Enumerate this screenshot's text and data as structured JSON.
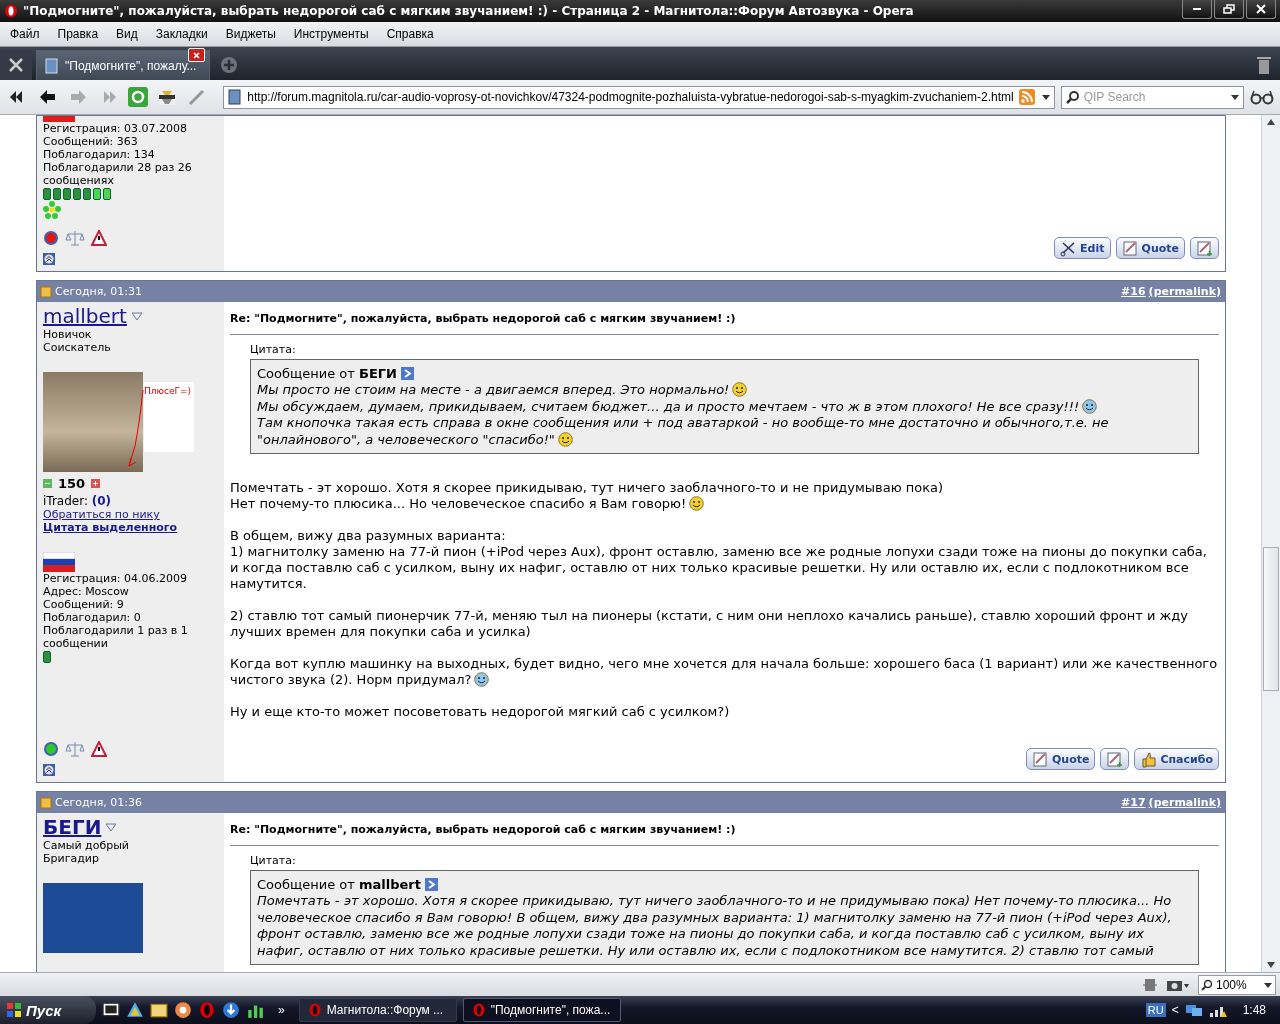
{
  "window": {
    "title": "\"Подмогните\", пожалуйста, выбрать недорогой саб с мягким звучанием! :) - Страница 2 - Магнитола::Форум Автозвука - Opera"
  },
  "menu": [
    "Файл",
    "Правка",
    "Вид",
    "Закладки",
    "Виджеты",
    "Инструменты",
    "Справка"
  ],
  "tabs": [
    {
      "label": "\"Подмогните\", пожалу...",
      "selected": true
    }
  ],
  "address": {
    "url": "http://forum.magnitola.ru/car-audio-voprosy-ot-novichkov/47324-podmognite-pozhaluista-vybratue-nedorogoi-sab-s-myagkim-zvuchaniem-2.html"
  },
  "search": {
    "placeholder": "QIP Search"
  },
  "posts": [
    {
      "flag": {
        "kind": "ru_cut"
      },
      "stats": [
        "Регистрация: 03.07.2008",
        "Сообщений: 363",
        "Поблагодарил: 134",
        "Поблагодарили 28 раз 26 сообщениях"
      ],
      "pips": [
        {
          "lit": false
        },
        {
          "lit": false
        },
        {
          "lit": false
        },
        {
          "lit": false
        },
        {
          "lit": false
        },
        {
          "lit": true
        },
        {
          "lit": true
        }
      ],
      "icq": true,
      "online": false,
      "buttons": [
        {
          "kind": "edit",
          "label": "Edit"
        },
        {
          "kind": "quote",
          "label": "Quote"
        },
        {
          "kind": "multiquote"
        }
      ]
    },
    {
      "date": "Сегодня, 01:31",
      "number": "#16",
      "permalink": "(permalink)",
      "username": "mallbert",
      "bold": false,
      "titles": [
        "Новичок",
        "Соискатель"
      ],
      "avatar": {
        "kind": "photo"
      },
      "annotation": "ПлюсеГ=)",
      "reputation": "150",
      "itrader_label": "iTrader:",
      "itrader": "(0)",
      "links": [
        "Обратиться по нику",
        "Цитата выделенного"
      ],
      "flag": {
        "kind": "ru"
      },
      "stats": [
        "Регистрация: 04.06.2009",
        "Адрес: Moscow",
        "Сообщений: 9",
        "Поблагодарил: 0",
        "Поблагодарили 1 раз в 1 сообщении"
      ],
      "pips": [
        {
          "lit": false
        }
      ],
      "online": true,
      "subject": "Re: \"Подмогните\", пожалуйста, выбрать недорогой саб с мягким звучанием! :)",
      "quote": {
        "label": "Цитата:",
        "from": "Сообщение от",
        "author": "БЕГИ",
        "lines": [
          {
            "text": "Мы просто не стоим на месте - а двигаемся вперед. Это нормально!",
            "smiley": {
              "kind": "smile"
            }
          },
          {
            "text": "Мы обсуждаем, думаем, прикидываем, считаем бюджет... да и просто мечтаем - что ж в этом плохого! Не все сразу!!!",
            "smiley": {
              "kind": "wink"
            }
          },
          {
            "text": "Там кнопочка такая есть справа в окне сообщения или + под аватаркой - но вообще-то мне достаточно и обычного,т.е. не"
          },
          {
            "text": "\"онлайнового\", а человеческого \"спасибо!\"",
            "smiley": {
              "kind": "smile"
            }
          }
        ]
      },
      "paragraphs": [
        [
          {
            "text": "Помечтать - эт хорошо. Хотя я скорее прикидываю, тут ничего заоблачного-то и не придумываю пока)"
          },
          {
            "text": "Нет почему-то плюсика... Но человеческое спасибо я Вам говорю!",
            "smiley": {
              "kind": "smile"
            }
          }
        ],
        [
          {
            "text": "В общем, вижу два разумных варианта:"
          },
          {
            "text": "1) магнитолку заменю на 77-й пион (+iPod через Aux), фронт оставлю, заменю все же родные лопухи сзади тоже на пионы до покупки саба, и когда поставлю саб с усилком, выну их нафиг, оставлю от них только красивые решетки. Ну или оставлю их, если с подлокотником все намутится."
          }
        ],
        [
          {
            "text": "2) ставлю тот самый пионерчик 77-й, меняю тыл на пионеры (кстати, с ним они неплохо качались раньше), ставлю хороший фронт и жду лучших времен для покупки саба и усилка)"
          }
        ],
        [
          {
            "text": "Когда вот куплю машинку на выходных, будет видно, чего мне хочется для начала больше: хорошего баса (1 вариант) или же качественного"
          },
          {
            "text": "чистого звука (2). Норм придумал?",
            "smiley": {
              "kind": "wink"
            }
          }
        ],
        [
          {
            "text": "Ну и еще кто-то может посоветовать недорогой мягкий саб с усилком?)"
          }
        ]
      ],
      "buttons": [
        {
          "kind": "quote",
          "label": "Quote"
        },
        {
          "kind": "multiquote"
        },
        {
          "kind": "thanks",
          "label": "Спасибо"
        }
      ]
    },
    {
      "date": "Сегодня, 01:36",
      "number": "#17",
      "permalink": "(permalink)",
      "username": "БЕГИ",
      "bold": true,
      "titles": [
        "Самый добрый",
        "Бригадир"
      ],
      "avatar": {
        "kind": "logo"
      },
      "subject": "Re: \"Подмогните\", пожалуйста, выбрать недорогой саб с мягким звучанием! :)",
      "quote": {
        "label": "Цитата:",
        "from": "Сообщение от",
        "author": "mallbert",
        "lines": [
          {
            "text": "Помечтать - эт хорошо. Хотя я скорее прикидываю, тут ничего заоблачного-то и не придумываю пока) Нет почему-то плюсика... Но"
          },
          {
            "text": "человеческое спасибо я Вам говорю! В общем, вижу два разумных варианта: 1) магнитолку заменю на 77-й пион (+iPod через Aux),"
          },
          {
            "text": "фронт оставлю, заменю все же родные лопухи сзади тоже на пионы до покупки саба, и когда поставлю саб с усилком, выну их"
          },
          {
            "text": "нафиг, оставлю от них только красивые решетки. Ну или оставлю их, если с подлокотником все намутится. 2) ставлю тот самый"
          }
        ]
      }
    }
  ],
  "status_bar": {
    "zoom": "100%"
  },
  "taskbar": {
    "start": "Пуск",
    "more": "»",
    "windows": [
      {
        "label": "Магнитола::Форум ...",
        "selected": false
      },
      {
        "label": "\"Подмогните\", пожа...",
        "selected": true
      }
    ],
    "language": "RU",
    "tray_arrow": "<",
    "clock": "1:48"
  }
}
